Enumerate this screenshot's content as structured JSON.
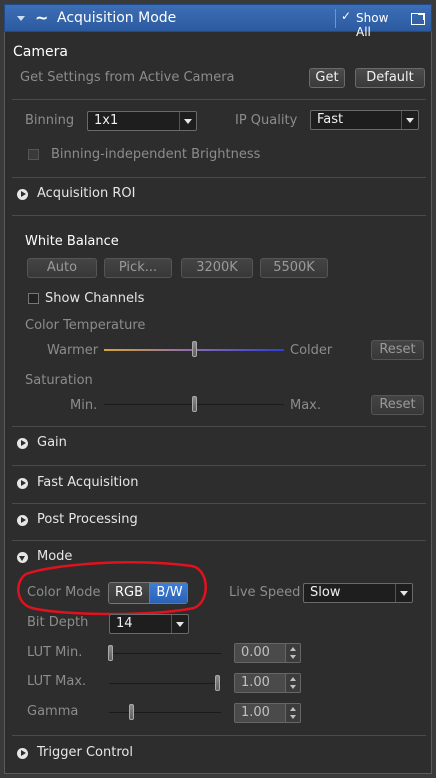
{
  "header": {
    "title": "Acquisition Mode",
    "show_all": "Show All"
  },
  "camera": {
    "section_title": "Camera",
    "get_settings_label": "Get Settings from Active Camera",
    "get_button": "Get",
    "default_button": "Default",
    "binning_label": "Binning",
    "binning_value": "1x1",
    "ip_quality_label": "IP Quality",
    "ip_quality_value": "Fast",
    "binning_independent_label": "Binning-independent Brightness"
  },
  "acquisition_roi": {
    "label": "Acquisition ROI"
  },
  "white_balance": {
    "title": "White Balance",
    "buttons": [
      "Auto",
      "Pick...",
      "3200K",
      "5500K"
    ],
    "show_channels_label": "Show Channels",
    "color_temp_label": "Color Temperature",
    "warmer_label": "Warmer",
    "colder_label": "Colder",
    "color_temp_level": 0.5,
    "reset_label": "Reset",
    "saturation_label": "Saturation",
    "min_label": "Min.",
    "max_label": "Max.",
    "saturation_level": 0.5,
    "saturation_reset_label": "Reset"
  },
  "sections": {
    "gain": "Gain",
    "fast_acquisition": "Fast Acquisition",
    "post_processing": "Post Processing",
    "mode": "Mode",
    "trigger_control": "Trigger Control"
  },
  "mode": {
    "color_mode_label": "Color Mode",
    "rgb_label": "RGB",
    "bw_label": "B/W",
    "live_speed_label": "Live Speed",
    "live_speed_value": "Slow",
    "bit_depth_label": "Bit Depth",
    "bit_depth_value": "14",
    "lut_min_label": "LUT Min.",
    "lut_min_value": "0.00",
    "lut_max_label": "LUT Max.",
    "lut_max_value": "1.00",
    "gamma_label": "Gamma",
    "gamma_value": "1.00"
  },
  "colors": {
    "accent": "#2c5aa0",
    "highlight": "#e0121d"
  }
}
